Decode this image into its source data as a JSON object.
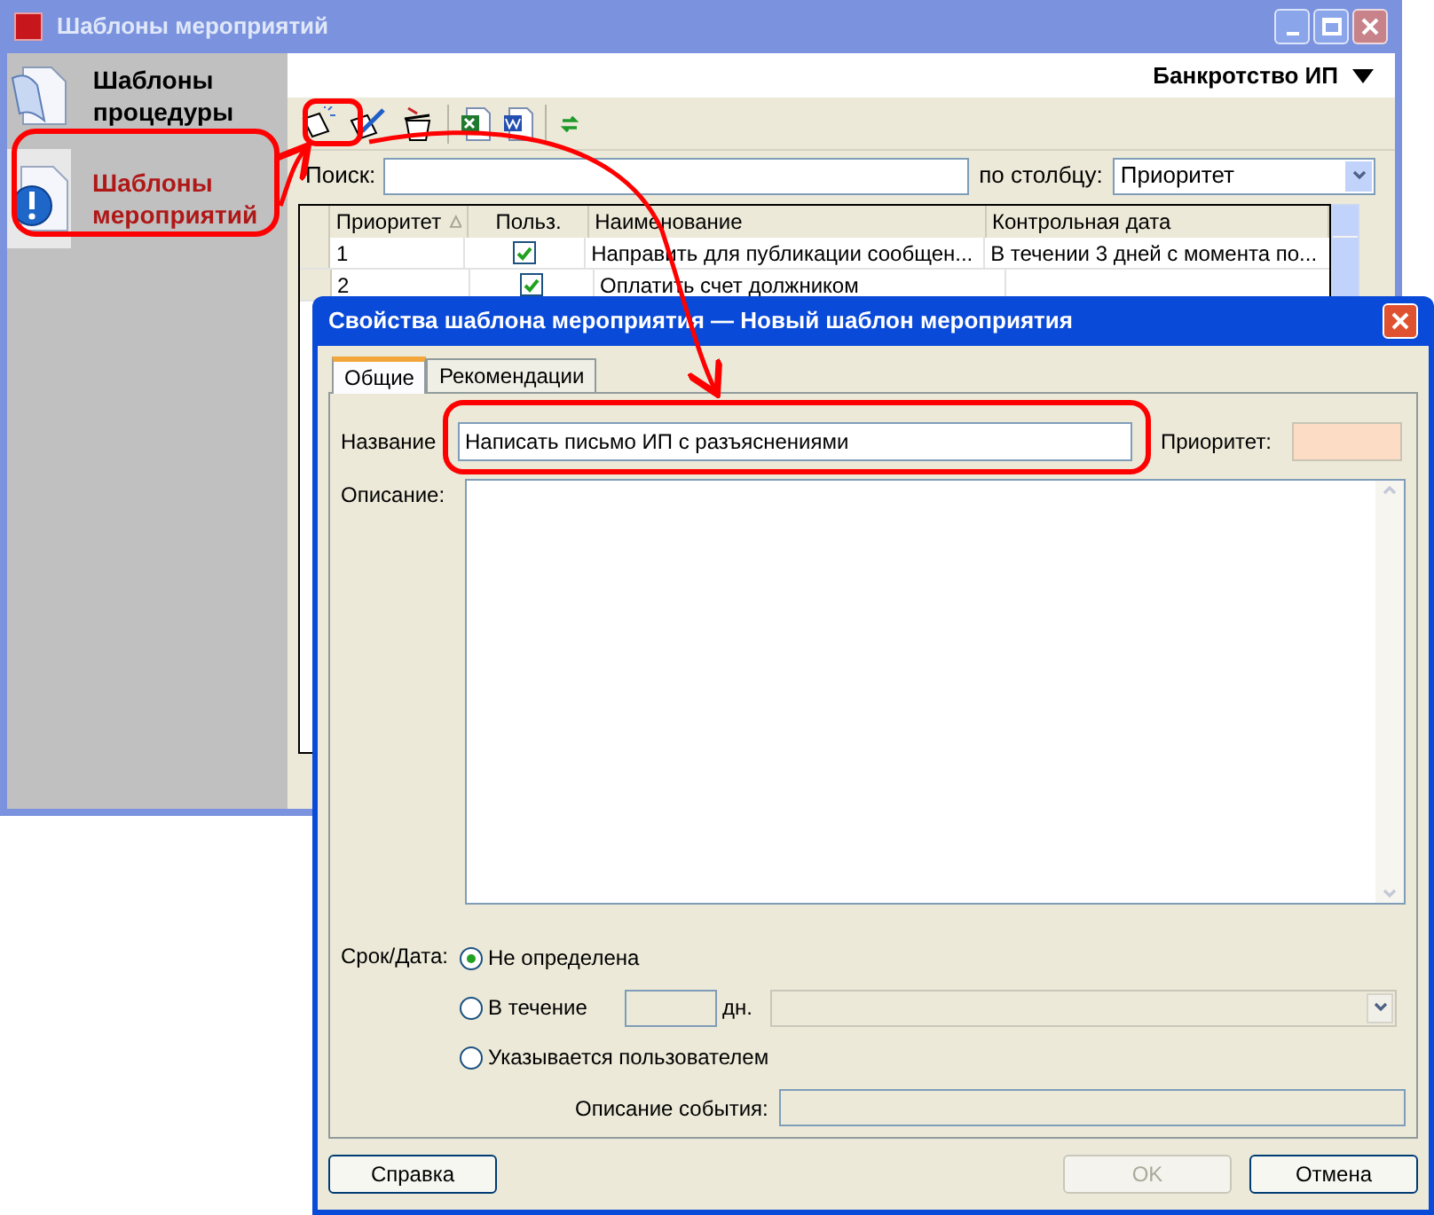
{
  "main_window": {
    "title": "Шаблоны мероприятий"
  },
  "sidebar": {
    "items": [
      {
        "label": "Шаблоны процедуры",
        "selected": false,
        "kind": "book"
      },
      {
        "label": "Шаблоны мероприятий",
        "selected": true,
        "kind": "info"
      }
    ]
  },
  "header": {
    "title": "Банкротство ИП"
  },
  "search": {
    "label": "Поиск:",
    "column_label": "по столбцу:",
    "column_value": "Приоритет"
  },
  "table": {
    "columns": [
      {
        "label": "Приоритет",
        "sorted": true
      },
      {
        "label": "Польз.",
        "sorted": false
      },
      {
        "label": "Наименование",
        "sorted": false
      },
      {
        "label": "Контрольная дата",
        "sorted": false
      }
    ],
    "rows": [
      {
        "priority": "1",
        "user": true,
        "name": "Направить для публикации сообщен...",
        "date": "В течении 3 дней с момента по..."
      },
      {
        "priority": "2",
        "user": true,
        "name": "Оплатить счет должником"
      }
    ]
  },
  "dialog": {
    "title": "Свойства шаблона мероприятия — Новый шаблон мероприятия",
    "tabs": [
      {
        "label": "Общие",
        "selected": true
      },
      {
        "label": "Рекомендации",
        "selected": false
      }
    ],
    "name_label": "Название",
    "name_value": "Написать письмо ИП с разъяснениями",
    "priority_label": "Приоритет:",
    "description_label": "Описание:",
    "deadline_label": "Срок/Дата:",
    "options": [
      {
        "kind": "plain",
        "label": "Не определена",
        "selected": true
      },
      {
        "kind": "days",
        "label": "В течение",
        "selected": false
      },
      {
        "kind": "user",
        "label": "Указывается пользователем",
        "selected": false
      }
    ],
    "days_unit": "дн.",
    "event_label": "Описание события:",
    "buttons": [
      {
        "kind": "left",
        "label": "Справка",
        "disabled": false
      },
      {
        "kind": "right",
        "label": "OK",
        "disabled": true
      },
      {
        "kind": "right",
        "label": "Отмена",
        "disabled": false
      }
    ]
  }
}
